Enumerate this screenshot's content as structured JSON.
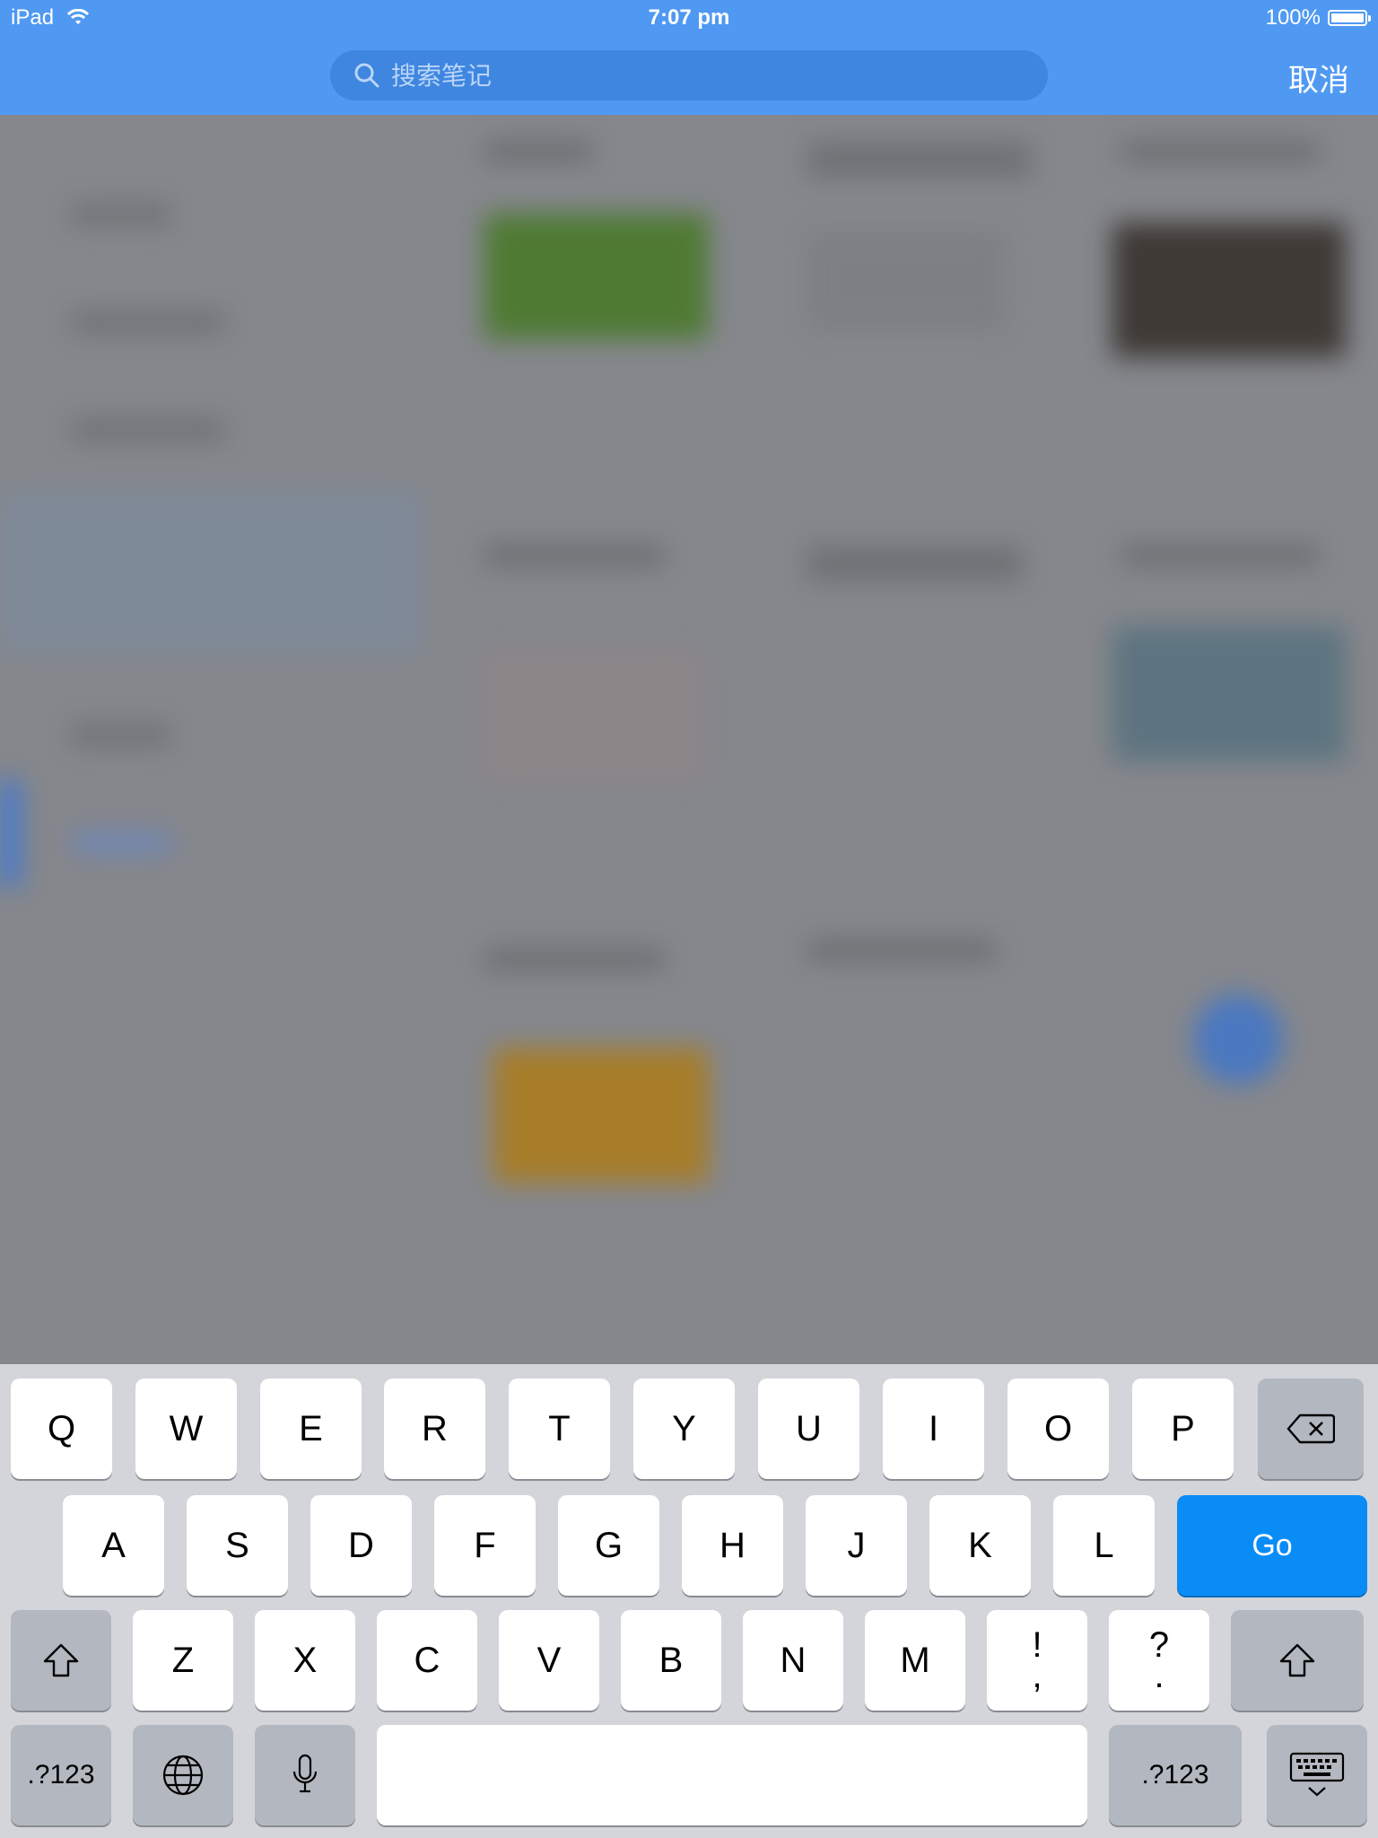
{
  "status_bar": {
    "device": "iPad",
    "time": "7:07 pm",
    "battery": "100%"
  },
  "search": {
    "placeholder": "搜索笔记"
  },
  "cancel_label": "取消",
  "keyboard": {
    "row1": [
      "Q",
      "W",
      "E",
      "R",
      "T",
      "Y",
      "U",
      "I",
      "O",
      "P"
    ],
    "row2": [
      "A",
      "S",
      "D",
      "F",
      "G",
      "H",
      "J",
      "K",
      "L"
    ],
    "row3": [
      "Z",
      "X",
      "C",
      "V",
      "B",
      "N",
      "M"
    ],
    "punct1": {
      "top": "!",
      "bottom": ","
    },
    "punct2": {
      "top": "?",
      "bottom": "."
    },
    "go_label": "Go",
    "numbers_label": ".?123",
    "icons": {
      "backspace": "backspace-icon",
      "shift": "shift-icon",
      "globe": "globe-icon",
      "mic": "microphone-icon",
      "hide": "keyboard-hide-icon"
    }
  }
}
